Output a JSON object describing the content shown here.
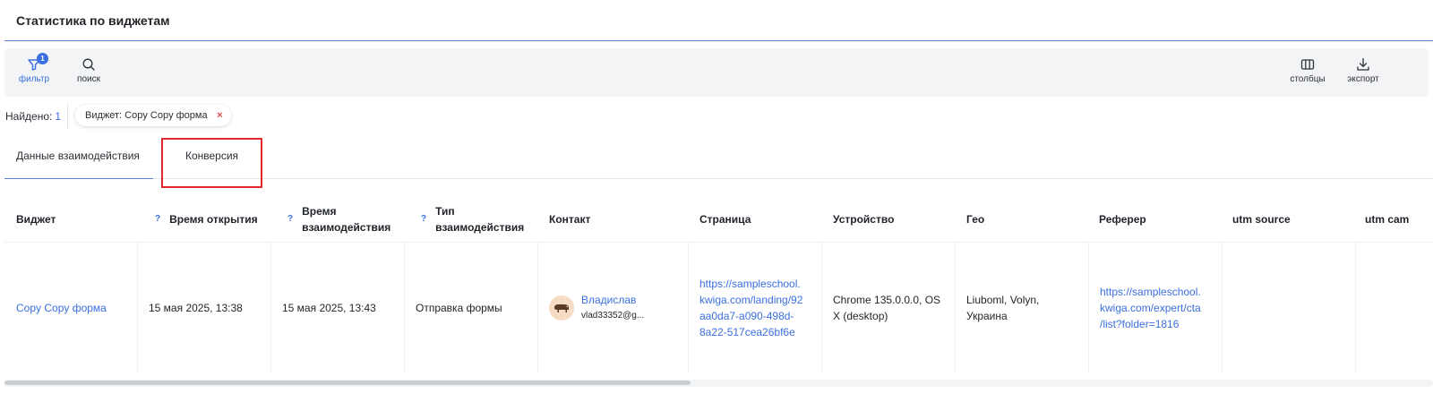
{
  "page": {
    "title": "Статистика по виджетам"
  },
  "toolbar": {
    "filter_label": "фильтр",
    "filter_badge": "1",
    "search_label": "поиск",
    "columns_label": "столбцы",
    "export_label": "экспорт",
    "accent_color": "#3b6fe0"
  },
  "results": {
    "found_label": "Найдено:",
    "found_count": "1",
    "active_filter_chip": "Виджет: Copy Copy форма"
  },
  "tabs": [
    {
      "label": "Данные взаимодействия",
      "active": true
    },
    {
      "label": "Конверсия",
      "active": false
    }
  ],
  "table": {
    "headers": [
      "Виджет",
      "Время открытия",
      "Время взаимодействия",
      "Тип взаимодействия",
      "Контакт",
      "Страница",
      "Устройство",
      "Гео",
      "Реферер",
      "utm source",
      "utm cam"
    ],
    "header_lines": {
      "interaction_time": [
        "Время",
        "взаимодействия"
      ],
      "interaction_type": [
        "Тип",
        "взаимодействия"
      ]
    },
    "rows": [
      {
        "widget": "Copy Copy форма",
        "open_time": "15 мая 2025, 13:38",
        "interaction_time": "15 мая 2025, 13:43",
        "interaction_type": "Отправка формы",
        "contact_name": "Владислав",
        "contact_email": "vlad33352@g...",
        "page_lines": [
          "https://sampleschool.",
          "kwiga.com/landing/92",
          "aa0da7-a090-498d-",
          "8a22-517cea26bf6e"
        ],
        "device_lines": [
          "Chrome 135.0.0.0, OS",
          "X (desktop)"
        ],
        "geo_lines": [
          "Liuboml, Volyn,",
          "Украина"
        ],
        "referer_lines": [
          "https://sampleschool.",
          "kwiga.com/expert/cta",
          "/list?folder=1816"
        ],
        "utm_source": "",
        "utm_campaign": ""
      }
    ]
  },
  "scrollbar": {
    "position_fraction": 0.0,
    "visible_fraction": 0.48
  }
}
